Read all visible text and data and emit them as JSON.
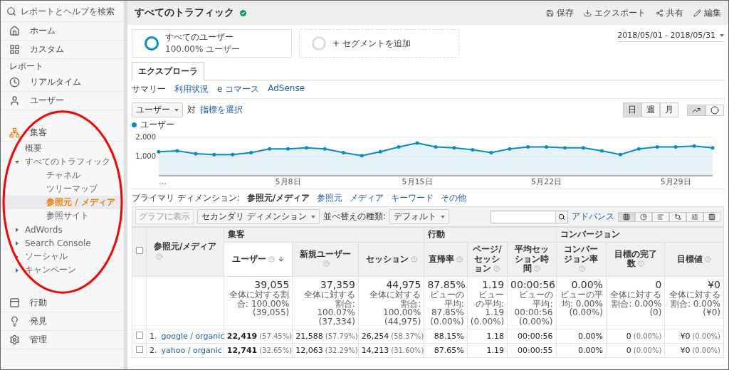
{
  "sidebar": {
    "search": {
      "placeholder": "レポートとヘルプを検索"
    },
    "nav": [
      {
        "kind": "item",
        "label": "ホーム",
        "active": false
      },
      {
        "kind": "item",
        "label": "カスタム",
        "active": false
      },
      {
        "kind": "heading",
        "label": "レポート"
      },
      {
        "kind": "item",
        "label": "リアルタイム",
        "active": false
      },
      {
        "kind": "item",
        "label": "ユーザー",
        "active": false
      },
      {
        "kind": "item",
        "label": "集客",
        "active": true,
        "circled": true,
        "children": [
          {
            "label": "概要",
            "selected": false
          },
          {
            "label": "すべてのトラフィック",
            "selected": false,
            "expanded": true,
            "children": [
              {
                "label": "チャネル",
                "selected": false
              },
              {
                "label": "ツリーマップ",
                "selected": false
              },
              {
                "label": "参照元 / メディア",
                "selected": true
              },
              {
                "label": "参照サイト",
                "selected": false
              }
            ]
          },
          {
            "label": "AdWords",
            "selected": false,
            "expanded": false
          },
          {
            "label": "Search Console",
            "selected": false,
            "expanded": false
          },
          {
            "label": "ソーシャル",
            "selected": false,
            "expanded": false
          },
          {
            "label": "キャンペーン",
            "selected": false,
            "expanded": false
          }
        ]
      },
      {
        "kind": "item",
        "label": "行動",
        "active": false
      },
      {
        "kind": "item",
        "label": "発見",
        "active": false
      },
      {
        "kind": "item",
        "label": "管理",
        "active": false
      }
    ]
  },
  "header": {
    "title": "すべてのトラフィック",
    "verified": true,
    "actions": [
      "保存",
      "エクスポート",
      "共有",
      "編集"
    ]
  },
  "segments": [
    {
      "name": "すべてのユーザー",
      "detail": "100.00% ユーザー",
      "active": true
    },
    {
      "name": "+ セグメントを追加",
      "active": false
    }
  ],
  "date_range": "2018/05/01 - 2018/05/31",
  "tabs": [
    {
      "label": "エクスプローラ",
      "selected": true
    }
  ],
  "subtabs": [
    {
      "label": "サマリー",
      "selected": true
    },
    {
      "label": "利用状況",
      "selected": false
    },
    {
      "label": "e コマース",
      "selected": false
    },
    {
      "label": "AdSense",
      "selected": false
    }
  ],
  "metric": {
    "value": "ユーザー",
    "versus": "対",
    "link": "指標を選択"
  },
  "periods": [
    {
      "label": "日",
      "selected": true
    },
    {
      "label": "週",
      "selected": false
    },
    {
      "label": "月",
      "selected": false
    }
  ],
  "chart_types": [
    {
      "kind": "line",
      "selected": true
    },
    {
      "kind": "motion",
      "selected": false
    }
  ],
  "chart": {
    "chart_data": {
      "type": "area",
      "categories": [
        "…",
        null,
        null,
        null,
        null,
        null,
        null,
        "5月8日",
        null,
        null,
        null,
        null,
        null,
        null,
        "5月15日",
        null,
        null,
        null,
        null,
        null,
        null,
        "5月22日",
        null,
        null,
        null,
        null,
        null,
        null,
        "5月29日",
        null,
        null
      ],
      "series": [
        {
          "name": "ユーザー",
          "color": "#058dc7",
          "values": [
            1250,
            1300,
            1150,
            1100,
            1100,
            1200,
            1400,
            1400,
            1450,
            1400,
            1200,
            1050,
            1250,
            1500,
            1700,
            1500,
            1450,
            1350,
            1200,
            1400,
            1500,
            1500,
            1450,
            1450,
            1300,
            1100,
            1400,
            1500,
            1500,
            1550,
            1450
          ]
        }
      ],
      "ylim": [
        0,
        2000
      ],
      "yticks": [
        {
          "value": 1000,
          "label": "1,000"
        },
        {
          "value": 2000,
          "label": "2,000"
        }
      ]
    }
  },
  "primary_dimension": {
    "label": "プライマリ ディメンション:",
    "current": "参照元/メディア",
    "options": [
      "参照元",
      "メディア",
      "キーワード",
      "その他"
    ]
  },
  "toolbar": {
    "plot_button": {
      "label": "グラフに表示",
      "disabled": true
    },
    "secondary": "セカンダリ ディメンション",
    "sort_label": "並べ替えの種類:",
    "sort": "デフォルト",
    "advanced": "アドバンス",
    "views": [
      {
        "selected": true
      },
      {
        "selected": false
      },
      {
        "selected": false
      },
      {
        "selected": false
      },
      {
        "selected": false
      },
      {
        "selected": false
      }
    ]
  },
  "table": {
    "all_checked": false,
    "dimension_column": "参照元/メディア",
    "groups": [
      {
        "label": "集客",
        "columns": [
          {
            "label": "ユーザー",
            "sorted": true
          },
          {
            "label": "新規ユーザー",
            "sorted": false
          },
          {
            "label": "セッション",
            "sorted": false
          }
        ]
      },
      {
        "label": "行動",
        "columns": [
          {
            "label": "直帰率",
            "sorted": false
          },
          {
            "label": "ページ/セッション",
            "sorted": false
          },
          {
            "label": "平均セッション時間",
            "sorted": false
          }
        ]
      },
      {
        "label": "コンバージョン",
        "columns": [
          {
            "label": "コンバージョン率",
            "sorted": false
          },
          {
            "label": "目標の完了数",
            "sorted": false
          },
          {
            "label": "目標値",
            "sorted": false
          }
        ]
      }
    ],
    "totals": [
      {
        "value": "39,055",
        "note": "全体に対する割合: 100.00% (39,055)"
      },
      {
        "value": "37,359",
        "note": "全体に対する割合: 100.07% (37,334)"
      },
      {
        "value": "44,975",
        "note": "全体に対する割合: 100.00% (44,975)"
      },
      {
        "value": "87.85%",
        "note": "ビューの平均: 87.85% (0.00%)"
      },
      {
        "value": "1.19",
        "note": "ビューの平均: 1.19 (0.00%)"
      },
      {
        "value": "00:00:56",
        "note": "ビューの平均: 00:00:56 (0.00%)"
      },
      {
        "value": "0.00%",
        "note": "ビューの平均: 0.00% (0.00%)"
      },
      {
        "value": "0",
        "note": "全体に対する割合: 0.00% (0)"
      },
      {
        "value": "¥0",
        "note": "全体に対する割合: 0.00% (¥0)"
      }
    ],
    "rows": [
      {
        "checked": false,
        "index": "1.",
        "source": "google / organic",
        "cells": [
          {
            "value": "22,419",
            "share": "(57.45%)"
          },
          {
            "value": "21,588",
            "share": "(57.79%)"
          },
          {
            "value": "26,254",
            "share": "(58.37%)"
          },
          {
            "value": "88.15%"
          },
          {
            "value": "1.18"
          },
          {
            "value": "00:00:56"
          },
          {
            "value": "0.00%"
          },
          {
            "value": "0",
            "share": "(0.00%)"
          },
          {
            "value": "¥0",
            "share": "(0.00%)"
          }
        ]
      },
      {
        "checked": false,
        "index": "2.",
        "source": "yahoo / organic",
        "cells": [
          {
            "value": "12,741",
            "share": "(32.65%)"
          },
          {
            "value": "12,063",
            "share": "(32.29%)"
          },
          {
            "value": "14,213",
            "share": "(31.60%)"
          },
          {
            "value": "87.65%"
          },
          {
            "value": "1.19"
          },
          {
            "value": "00:00:55"
          },
          {
            "value": "0.00%"
          },
          {
            "value": "0",
            "share": "(0.00%)"
          },
          {
            "value": "¥0",
            "share": "(0.00%)"
          }
        ]
      }
    ]
  }
}
